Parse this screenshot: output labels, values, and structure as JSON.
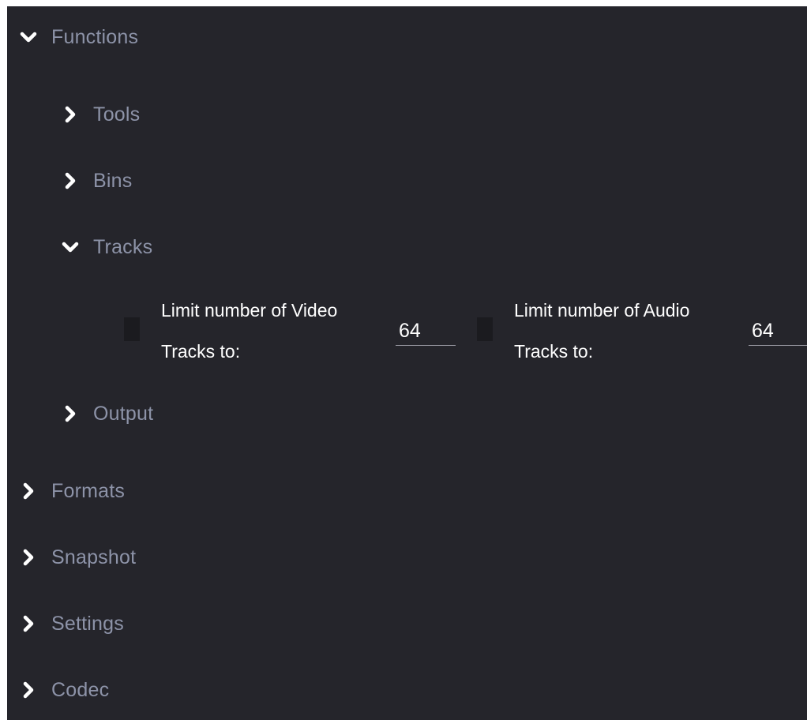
{
  "colors": {
    "panel_bg": "#25252b",
    "label_gray": "#8d93a8",
    "text_white": "#ffffff",
    "checkbox_bg": "#1b1b1f"
  },
  "tree": {
    "functions": {
      "label": "Functions",
      "icon": "chevron-down-icon",
      "expanded": true
    },
    "tools": {
      "label": "Tools",
      "icon": "chevron-right-icon"
    },
    "bins": {
      "label": "Bins",
      "icon": "chevron-right-icon"
    },
    "tracks": {
      "label": "Tracks",
      "icon": "chevron-down-icon",
      "expanded": true
    },
    "output": {
      "label": "Output",
      "icon": "chevron-right-icon"
    },
    "formats": {
      "label": "Formats",
      "icon": "chevron-right-icon"
    },
    "snapshot": {
      "label": "Snapshot",
      "icon": "chevron-right-icon"
    },
    "settings": {
      "label": "Settings",
      "icon": "chevron-right-icon"
    },
    "codec": {
      "label": "Codec",
      "icon": "chevron-right-icon"
    }
  },
  "tracks_options": {
    "video": {
      "label_line1": "Limit number of Video",
      "label_line2": "Tracks to:",
      "value": "64"
    },
    "audio": {
      "label_line1": "Limit number of Audio",
      "label_line2": "Tracks to:",
      "value": "64"
    }
  }
}
